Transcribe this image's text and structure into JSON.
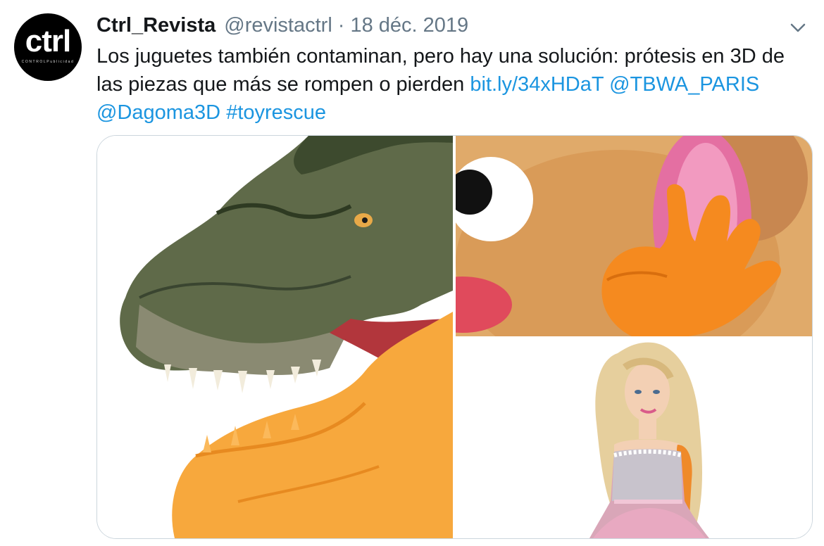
{
  "tweet": {
    "avatar": {
      "logo_text": "ctrl",
      "tagline": "CONTROLPublicidad"
    },
    "display_name": "Ctrl_Revista",
    "handle": "@revistactrl",
    "separator": "·",
    "date": "18 déc. 2019",
    "text_plain": "Los juguetes también contaminan, pero hay una solución: prótesis en 3D de las piezas que más se rompen o pierden",
    "links": {
      "short_url": "bit.ly/34xHDaT",
      "mention_1": "@TBWA_PARIS",
      "mention_2": "@Dagoma3D",
      "hashtag": "#toyrescue"
    },
    "menu_icon": "chevron-down-icon",
    "media": [
      {
        "subject": "t-rex-toy-with-3d-printed-jaw"
      },
      {
        "subject": "potato-head-with-3d-printed-hand"
      },
      {
        "subject": "doll-with-3d-printed-arm"
      }
    ]
  },
  "colors": {
    "link": "#1b95e0",
    "secondary_text": "#657786",
    "primary_text": "#14171a",
    "border": "#ccd6dd"
  }
}
